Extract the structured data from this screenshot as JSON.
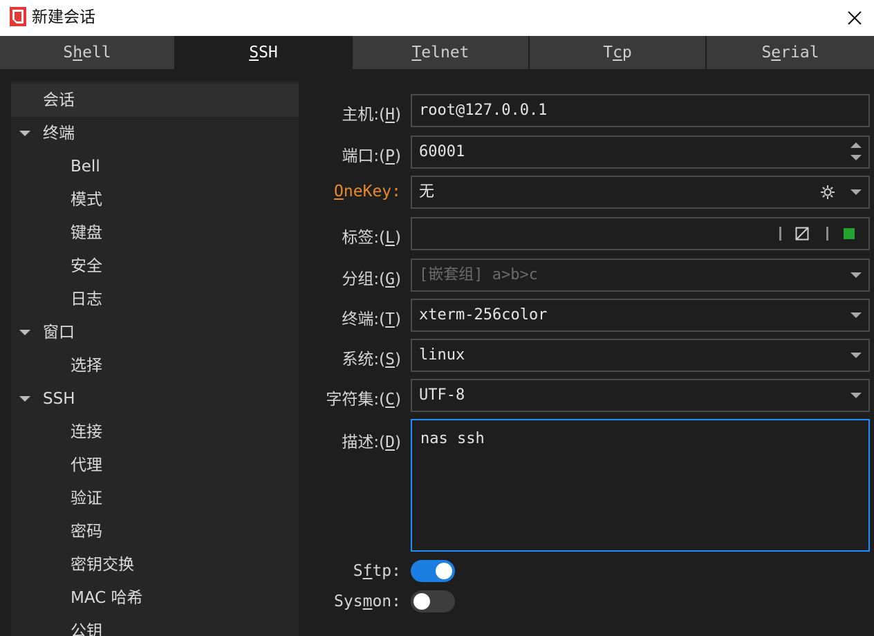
{
  "window": {
    "title": "新建会话"
  },
  "tabs": [
    {
      "pre": "S",
      "ul": "h",
      "post": "ell"
    },
    {
      "pre": "",
      "ul": "S",
      "post": "SH"
    },
    {
      "pre": "",
      "ul": "T",
      "post": "elnet"
    },
    {
      "pre": "T",
      "ul": "c",
      "post": "p"
    },
    {
      "pre": "S",
      "ul": "e",
      "post": "rial"
    }
  ],
  "tree": {
    "items": [
      {
        "label": "会话"
      },
      {
        "label": "终端"
      },
      {
        "label": "Bell"
      },
      {
        "label": "模式"
      },
      {
        "label": "键盘"
      },
      {
        "label": "安全"
      },
      {
        "label": "日志"
      },
      {
        "label": "窗口"
      },
      {
        "label": "选择"
      },
      {
        "label": "SSH"
      },
      {
        "label": "连接"
      },
      {
        "label": "代理"
      },
      {
        "label": "验证"
      },
      {
        "label": "密码"
      },
      {
        "label": "密钥交换"
      },
      {
        "label": "MAC 哈希"
      },
      {
        "label": "公钥"
      }
    ]
  },
  "form": {
    "host": {
      "label_pre": "主机:(",
      "ul": "H",
      "label_post": ")",
      "value": "root@127.0.0.1"
    },
    "port": {
      "label_pre": "端口:(",
      "ul": "P",
      "label_post": ")",
      "value": "60001"
    },
    "onekey": {
      "label_pre": "",
      "ul": "O",
      "label_post": "neKey:",
      "value": "无",
      "color": "#e8892c"
    },
    "tag": {
      "label_pre": "标签:(",
      "ul": "L",
      "label_post": ")",
      "value": "",
      "color_swatch": "#22a32e"
    },
    "group": {
      "label_pre": "分组:(",
      "ul": "G",
      "label_post": ")",
      "placeholder": "[嵌套组] a>b>c"
    },
    "terminal": {
      "label_pre": "终端:(",
      "ul": "T",
      "label_post": ")",
      "value": "xterm-256color"
    },
    "system": {
      "label_pre": "系统:(",
      "ul": "S",
      "label_post": ")",
      "value": "linux"
    },
    "charset": {
      "label_pre": "字符集:(",
      "ul": "C",
      "label_post": ")",
      "value": "UTF-8"
    },
    "desc": {
      "label_pre": "描述:(",
      "ul": "D",
      "label_post": ")",
      "value": "nas ssh"
    },
    "sftp": {
      "label_pre": "S",
      "ul": "f",
      "label_post": "tp:",
      "on": true
    },
    "sysmon": {
      "label_pre": "Sys",
      "ul": "m",
      "label_post": "on:",
      "on": false
    }
  },
  "colors": {
    "accent": "#1a7fe0",
    "focus_border": "#1f8fff",
    "onekey": "#e8892c",
    "tag_green": "#22a32e"
  }
}
